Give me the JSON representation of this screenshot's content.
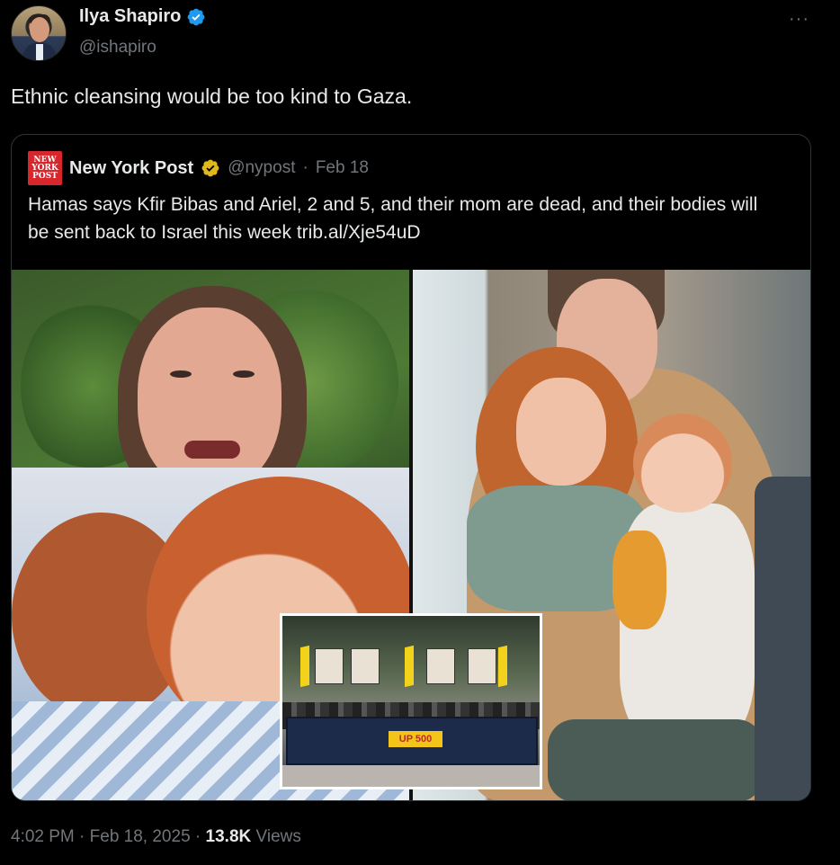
{
  "post": {
    "author": {
      "display_name": "Ilya Shapiro",
      "handle": "@ishapiro",
      "verified": true
    },
    "more_glyph": "···",
    "text": "Ethnic cleansing would be too kind to Gaza.",
    "quote": {
      "logo_lines": [
        "NEW",
        "YORK",
        "POST"
      ],
      "display_name": "New York Post",
      "handle": "@nypost",
      "separator": "·",
      "date": "Feb 18",
      "text": "Hamas says Kfir Bibas and Ariel, 2 and 5, and their mom are dead, and their bodies will be sent back to Israel this week",
      "link": "trib.al/Xje54uD",
      "inset_banner_text": "UP 500"
    },
    "footer": {
      "time": "4:02 PM",
      "sep1": "·",
      "date": "Feb 18, 2025",
      "sep2": "·",
      "views_count": "13.8K",
      "views_label": "Views"
    }
  },
  "colors": {
    "background": "#000000",
    "text_primary": "#e7e9ea",
    "text_secondary": "#71767b",
    "verified_blue": "#1d9bf0",
    "verified_gold": "#e2b719",
    "border": "#2f3336",
    "nypost_red": "#d7262c"
  },
  "icons": {
    "author_badge": "verified-blue-icon",
    "quote_badge": "verified-gold-icon",
    "more": "more-options-icon"
  }
}
